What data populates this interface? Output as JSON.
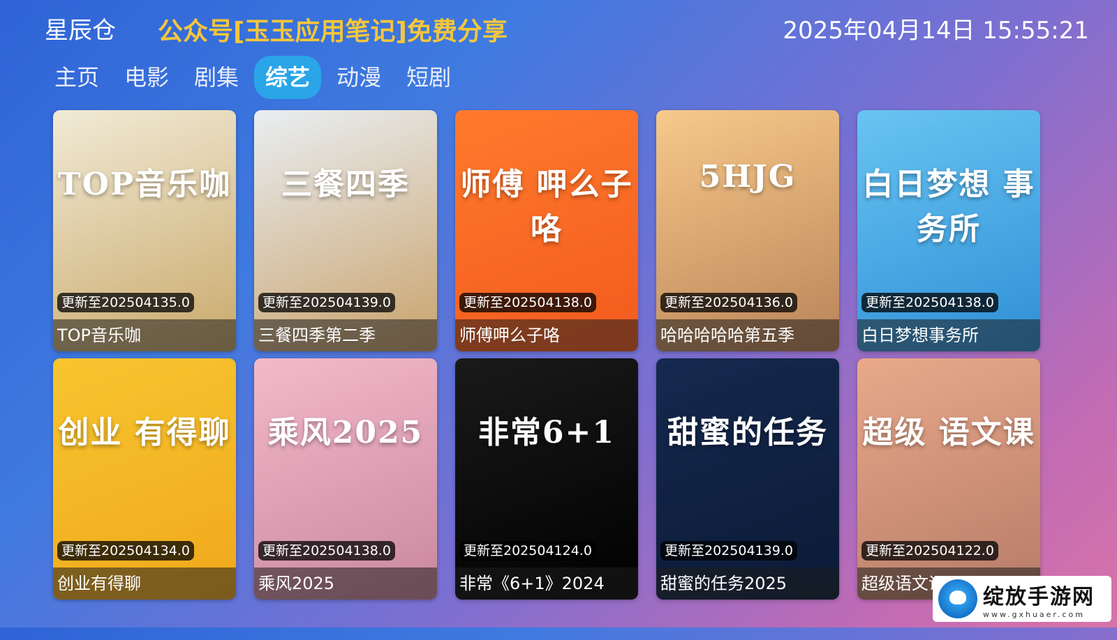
{
  "header": {
    "app_name": "星辰仓",
    "promo": "公众号[玉玉应用笔记]免费分享",
    "datetime": "2025年04月14日 15:55:21"
  },
  "tabs": [
    {
      "label": "主页",
      "active": false
    },
    {
      "label": "电影",
      "active": false
    },
    {
      "label": "剧集",
      "active": false
    },
    {
      "label": "综艺",
      "active": true
    },
    {
      "label": "动漫",
      "active": false
    },
    {
      "label": "短剧",
      "active": false
    }
  ],
  "cards": [
    {
      "title": "TOP音乐咖",
      "badge": "更新至202504135.0",
      "poster_text": "TOP音乐咖",
      "colors": [
        "#f1ead6",
        "#c9a96a"
      ]
    },
    {
      "title": "三餐四季第二季",
      "badge": "更新至202504139.0",
      "poster_text": "三餐四季",
      "colors": [
        "#e9eef2",
        "#c9a26b"
      ]
    },
    {
      "title": "师傅呷么子咯",
      "badge": "更新至202504138.0",
      "poster_text": "师傅 呷么子咯",
      "colors": [
        "#ff7a2c",
        "#f25a1e"
      ]
    },
    {
      "title": "哈哈哈哈哈第五季",
      "badge": "更新至202504136.0",
      "poster_text": "5HJG",
      "colors": [
        "#f7c98a",
        "#b98358"
      ]
    },
    {
      "title": "白日梦想事务所",
      "badge": "更新至202504138.0",
      "poster_text": "白日梦想 事务所",
      "colors": [
        "#69c4f2",
        "#2e8fd6"
      ]
    },
    {
      "title": "创业有得聊",
      "badge": "更新至202504134.0",
      "poster_text": "创业 有得聊",
      "colors": [
        "#f7c52f",
        "#f0a81c"
      ]
    },
    {
      "title": "乘风2025",
      "badge": "更新至202504138.0",
      "poster_text": "乘风2025",
      "colors": [
        "#f3b9c9",
        "#c9879f"
      ]
    },
    {
      "title": "非常《6+1》2024",
      "badge": "更新至202504124.0",
      "poster_text": "非常6+1",
      "colors": [
        "#1a1a1a",
        "#000000"
      ]
    },
    {
      "title": "甜蜜的任务2025",
      "badge": "更新至202504139.0",
      "poster_text": "甜蜜的任务",
      "colors": [
        "#15294f",
        "#0b1a36"
      ]
    },
    {
      "title": "超级语文课",
      "badge": "更新至202504122.0",
      "poster_text": "超级 语文课",
      "colors": [
        "#e9a98a",
        "#b67b68"
      ]
    }
  ],
  "watermark": {
    "text": "绽放手游网",
    "url": "www.gxhuaer.com"
  }
}
